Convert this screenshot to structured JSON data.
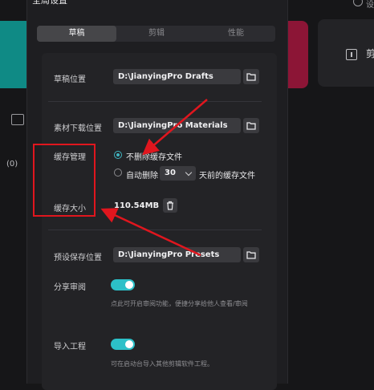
{
  "panel": {
    "title": "全局设置"
  },
  "tabs": [
    {
      "label": "草稿",
      "active": true
    },
    {
      "label": "剪辑",
      "active": false
    },
    {
      "label": "性能",
      "active": false
    }
  ],
  "draft": {
    "location_label": "草稿位置",
    "location_value": "D:\\JianyingPro Drafts"
  },
  "material": {
    "location_label": "素材下载位置",
    "location_value": "D:\\JianyingPro Materials"
  },
  "cache": {
    "manage_label": "缓存管理",
    "option_keep": "不删除缓存文件",
    "option_auto_prefix": "自动删除",
    "auto_days": "30",
    "option_auto_suffix": "天前的缓存文件",
    "size_label": "缓存大小",
    "size_value": "110.54MB"
  },
  "preset": {
    "location_label": "预设保存位置",
    "location_value": "D:\\JianyingPro Presets"
  },
  "share_review": {
    "label": "分享审阅",
    "hint": "点此可开启审阅功能，便捷分享给他人查看/审阅",
    "enabled": true
  },
  "import_project": {
    "label": "导入工程",
    "hint": "可在启动台导入其他剪辑软件工程。",
    "enabled": true
  },
  "background": {
    "left_count": "(0)",
    "right_text": "剪",
    "top_right_text": "设"
  },
  "colors": {
    "accent": "#2cc0c8",
    "annotation": "#e0161e",
    "panel_bg": "#1e1e21"
  }
}
